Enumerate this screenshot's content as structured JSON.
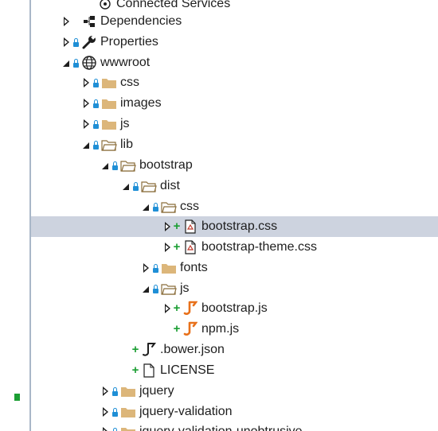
{
  "colors": {
    "lock": "#1f8fd6",
    "added": "#1b9e33",
    "folder": "#dcb67a",
    "js": "#e8711b",
    "selection": "#cdd3df"
  },
  "tree": [
    {
      "label": "Connected Services",
      "icon": "connected-services-icon",
      "expander": "none",
      "status": "none"
    },
    {
      "label": "Dependencies",
      "icon": "dependencies-icon",
      "expander": "collapsed",
      "status": "none"
    },
    {
      "label": "Properties",
      "icon": "wrench-icon",
      "expander": "collapsed",
      "status": "lock"
    },
    {
      "label": "wwwroot",
      "icon": "globe-icon",
      "expander": "expanded",
      "status": "lock"
    },
    {
      "label": "css",
      "icon": "folder-icon",
      "expander": "collapsed",
      "status": "lock"
    },
    {
      "label": "images",
      "icon": "folder-icon",
      "expander": "collapsed",
      "status": "lock"
    },
    {
      "label": "js",
      "icon": "folder-icon",
      "expander": "collapsed",
      "status": "lock"
    },
    {
      "label": "lib",
      "icon": "folder-open-icon",
      "expander": "expanded",
      "status": "lock"
    },
    {
      "label": "bootstrap",
      "icon": "folder-open-icon",
      "expander": "expanded",
      "status": "lock"
    },
    {
      "label": "dist",
      "icon": "folder-open-icon",
      "expander": "expanded",
      "status": "lock"
    },
    {
      "label": "css",
      "icon": "folder-open-icon",
      "expander": "expanded",
      "status": "lock"
    },
    {
      "label": "bootstrap.css",
      "icon": "css-file-icon",
      "expander": "collapsed",
      "status": "added",
      "selected": true
    },
    {
      "label": "bootstrap-theme.css",
      "icon": "css-file-icon",
      "expander": "collapsed",
      "status": "added"
    },
    {
      "label": "fonts",
      "icon": "folder-icon",
      "expander": "collapsed",
      "status": "lock"
    },
    {
      "label": "js",
      "icon": "folder-open-icon",
      "expander": "expanded",
      "status": "lock"
    },
    {
      "label": "bootstrap.js",
      "icon": "js-file-icon",
      "expander": "collapsed",
      "status": "added"
    },
    {
      "label": "npm.js",
      "icon": "js-file-icon",
      "expander": "none",
      "status": "added"
    },
    {
      "label": ".bower.json",
      "icon": "json-file-icon",
      "expander": "none",
      "status": "added"
    },
    {
      "label": "LICENSE",
      "icon": "file-icon",
      "expander": "none",
      "status": "added"
    },
    {
      "label": "jquery",
      "icon": "folder-icon",
      "expander": "collapsed",
      "status": "lock"
    },
    {
      "label": "jquery-validation",
      "icon": "folder-icon",
      "expander": "collapsed",
      "status": "lock"
    },
    {
      "label": "jquery-validation-unobtrusive",
      "icon": "folder-icon",
      "expander": "collapsed",
      "status": "lock"
    }
  ]
}
